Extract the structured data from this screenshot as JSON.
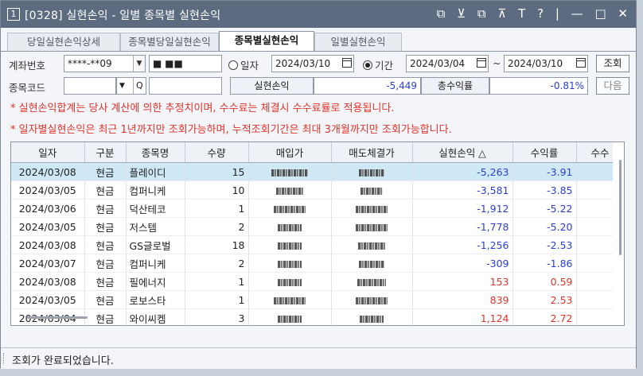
{
  "window": {
    "number": "1",
    "title": "[0328] 실현손익 - 일별 종목별 실현손익",
    "controls": [
      "⧉",
      "⊻",
      "⧉",
      "⊼",
      "T",
      "?",
      "|",
      "—",
      "□",
      "✕"
    ]
  },
  "tabs": [
    "당일실현손익상세",
    "종목별당일실현손익",
    "종목별실현손익",
    "일별실현손익"
  ],
  "active_tab": 2,
  "filters": {
    "account_label": "계좌번호",
    "account_value": "****-**09",
    "account_name": "■ ■■",
    "radio_date_label": "일자",
    "date_value": "2024/03/10",
    "radio_period_label": "기간",
    "period_from": "2024/03/04",
    "period_sep": "~",
    "period_to": "2024/03/10",
    "search_button": "조회",
    "code_label": "종목코드",
    "code_value": "",
    "search_glyph": "Q",
    "pnl_label": "실현손익",
    "pnl_value": "-5,449",
    "yield_label": "총수익률",
    "yield_value": "-0.81%",
    "next_button": "다음"
  },
  "notes": [
    "* 실현손익합계는 당사 계산에 의한 추정치이며, 수수료는 체결시 수수료률로 적용됩니다.",
    "* 일자별실현손익은 최근 1년까지만 조회가능하며, 누적조회기간은 최대 3개월까지만 조회가능합니다."
  ],
  "table": {
    "columns": [
      "일자",
      "구분",
      "종목명",
      "수량",
      "매입가",
      "매도체결가",
      "실현손익 △",
      "수익률",
      "수수"
    ],
    "rows": [
      {
        "date": "2024/03/08",
        "type": "현금",
        "name": "플레이디",
        "qty": "15",
        "pnl": "-5,263",
        "rate": "-3.91"
      },
      {
        "date": "2024/03/05",
        "type": "현금",
        "name": "컴퍼니케",
        "qty": "10",
        "pnl": "-3,581",
        "rate": "-3.85"
      },
      {
        "date": "2024/03/06",
        "type": "현금",
        "name": "덕산테코",
        "qty": "1",
        "pnl": "-1,912",
        "rate": "-5.22"
      },
      {
        "date": "2024/03/05",
        "type": "현금",
        "name": "저스템",
        "qty": "2",
        "pnl": "-1,778",
        "rate": "-5.20"
      },
      {
        "date": "2024/03/08",
        "type": "현금",
        "name": "GS글로벌",
        "qty": "18",
        "pnl": "-1,256",
        "rate": "-2.53"
      },
      {
        "date": "2024/03/07",
        "type": "현금",
        "name": "컴퍼니케",
        "qty": "2",
        "pnl": "-309",
        "rate": "-1.86"
      },
      {
        "date": "2024/03/08",
        "type": "현금",
        "name": "필에너지",
        "qty": "1",
        "pnl": "153",
        "rate": "0.59"
      },
      {
        "date": "2024/03/05",
        "type": "현금",
        "name": "로보스타",
        "qty": "1",
        "pnl": "839",
        "rate": "2.53"
      },
      {
        "date": "2024/03/04",
        "type": "현금",
        "name": "와이씨켐",
        "qty": "3",
        "pnl": "1,124",
        "rate": "2.72"
      }
    ]
  },
  "status": "조회가 완료되었습니다.",
  "colors": {
    "negative": "#2a3fd0",
    "positive": "#e0342c",
    "titlebar": "#5d6b80",
    "selected_row": "#cfe8f6"
  }
}
